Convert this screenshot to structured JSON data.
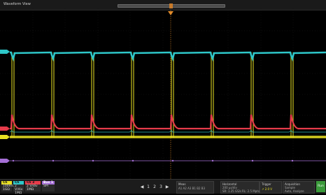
{
  "window": {
    "title": "Waveform View"
  },
  "waveforms": {
    "period": 57,
    "count": 8,
    "ch_cyan_color": "#2ec7c9",
    "ch_red_color": "#e63b4a",
    "ch_yellow_color": "#e8e022",
    "ch_purple_color": "#a56fd6",
    "trigger_color": "#e08a2a",
    "grid_color": "#3a3a3a"
  },
  "channels": [
    {
      "name": "Ch 1",
      "line1": "100mV/div",
      "line2": "1GΩ",
      "color": "#e8e022"
    },
    {
      "name": "Ch 2",
      "line1": "2 V/div",
      "line2": "1MΩ",
      "color": "#2ec7c9"
    },
    {
      "name": "Ch 3",
      "line1": "2 V/div",
      "line2": "1MΩ",
      "color": "#e63b4a"
    },
    {
      "name": "Bus 1",
      "line1": "SPI",
      "line2": "",
      "color": "#a56fd6"
    }
  ],
  "nav": [
    "◀",
    "1",
    "2",
    "3",
    "▶"
  ],
  "measure": {
    "title": "Meas",
    "text": "A1 A2 A3 B1 B2 B3"
  },
  "horizontal": {
    "title": "Horizontal",
    "line1": "200 µs/div",
    "line2": "SR: 1.25 GS/s",
    "line3": "RL: 2.5 Mpts"
  },
  "acquisition": {
    "title": "Acquisition",
    "line1": "Sample",
    "line2": "Auto, Analyze"
  },
  "trigger": {
    "title": "Trigger",
    "line1": "↗ 2.0 V"
  },
  "run_label": "Run"
}
